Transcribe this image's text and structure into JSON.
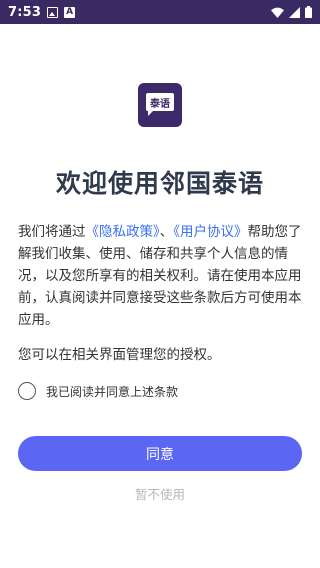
{
  "status_bar": {
    "time": "7:53",
    "icons": [
      "image-icon",
      "text-a-icon",
      "wifi-icon",
      "signal-icon",
      "battery-icon"
    ],
    "color": "#3a2a63"
  },
  "app": {
    "logo_text": "泰语",
    "logo_color": "#3c2a6b"
  },
  "dialog": {
    "title": "欢迎使用邻国泰语",
    "intro_before": "我们将通过",
    "privacy_link": "《隐私政策》",
    "separator": "、",
    "agreement_link": "《用户协议》",
    "intro_after": "帮助您了解我们收集、使用、储存和共享个人信息的情况，以及您所享有的相关权利。请在使用本应用前，认真阅读并同意接受这些条款后方可使用本应用。",
    "manage_text": "您可以在相关界面管理您的授权。",
    "consent_label": "我已阅读并同意上述条款",
    "consent_checked": false,
    "agree_label": "同意",
    "decline_label": "暂不使用"
  },
  "colors": {
    "accent": "#5b66f2",
    "link": "#3a6ff2",
    "title": "#2f3a4d"
  }
}
